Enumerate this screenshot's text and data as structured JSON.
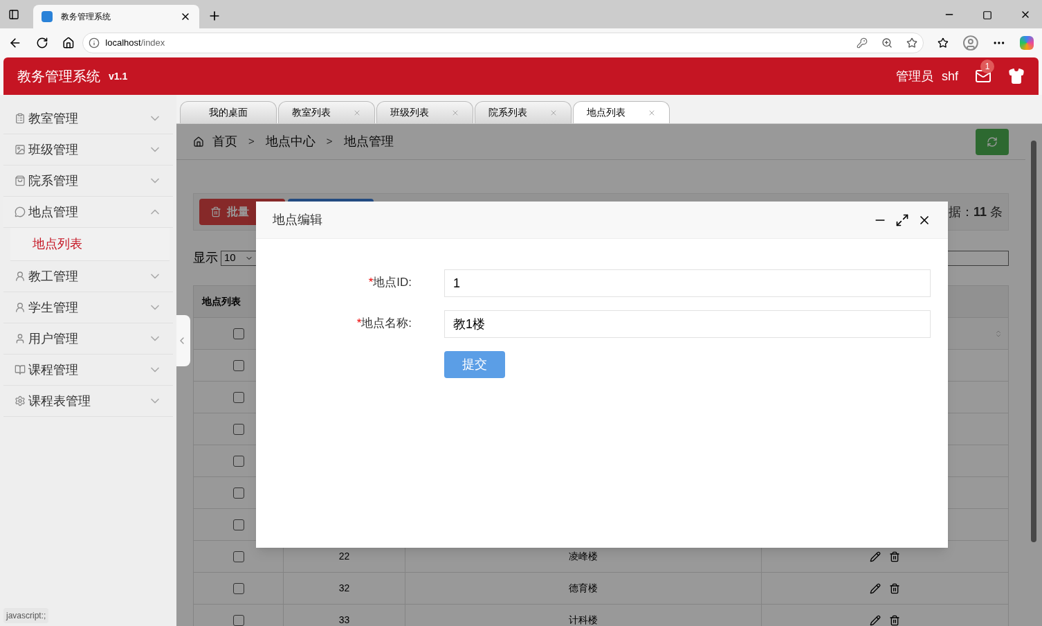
{
  "browser": {
    "tab_title": "教务管理系统",
    "url_host": "localhost",
    "url_path": "/index",
    "status_text": "javascript:;"
  },
  "header": {
    "title": "教务管理系统",
    "version": "v1.1",
    "user": "管理员",
    "username": "shf",
    "mail_badge": "1"
  },
  "sidebar": {
    "items": [
      {
        "label": "教室管理",
        "expanded": false
      },
      {
        "label": "班级管理",
        "expanded": false
      },
      {
        "label": "院系管理",
        "expanded": false
      },
      {
        "label": "地点管理",
        "expanded": true,
        "children": [
          {
            "label": "地点列表",
            "selected": true
          }
        ]
      },
      {
        "label": "教工管理",
        "expanded": false
      },
      {
        "label": "学生管理",
        "expanded": false
      },
      {
        "label": "用户管理",
        "expanded": false
      },
      {
        "label": "课程管理",
        "expanded": false
      },
      {
        "label": "课程表管理",
        "expanded": false
      }
    ]
  },
  "tabs": [
    {
      "label": "我的桌面",
      "closable": false,
      "selected": false
    },
    {
      "label": "教室列表",
      "closable": true,
      "selected": false
    },
    {
      "label": "班级列表",
      "closable": true,
      "selected": false
    },
    {
      "label": "院系列表",
      "closable": true,
      "selected": false
    },
    {
      "label": "地点列表",
      "closable": true,
      "selected": true
    }
  ],
  "breadcrumb": [
    {
      "kind": "link",
      "text": "首页"
    },
    {
      "kind": "separator",
      "text": ">"
    },
    {
      "kind": "link",
      "text": "地点中心"
    },
    {
      "kind": "separator",
      "text": ">"
    },
    {
      "kind": "link",
      "text": "地点管理"
    }
  ],
  "toolbar": {
    "delete_button": "批量",
    "total": "据：**11** 条"
  },
  "page_size": {
    "label": "显示",
    "value": "10"
  },
  "table": {
    "caption": "地点列表",
    "header_checked": false,
    "rows": [
      {
        "checked": false
      },
      {
        "checked": false
      },
      {
        "checked": false
      },
      {
        "checked": false
      },
      {
        "checked": false
      },
      {
        "checked": false
      },
      {
        "checked": false,
        "id": "22",
        "name": "凌峰楼"
      },
      {
        "checked": false,
        "id": "32",
        "name": "德育楼"
      },
      {
        "checked": false,
        "id": "33",
        "name": "计科楼"
      }
    ]
  },
  "dialog": {
    "title": "地点编辑",
    "fields": [
      {
        "required_mark": "*",
        "label": "地点ID:",
        "value": "1"
      },
      {
        "required_mark": "*",
        "label": "地点名称:",
        "value": "教1楼"
      }
    ],
    "submit": "提交"
  }
}
